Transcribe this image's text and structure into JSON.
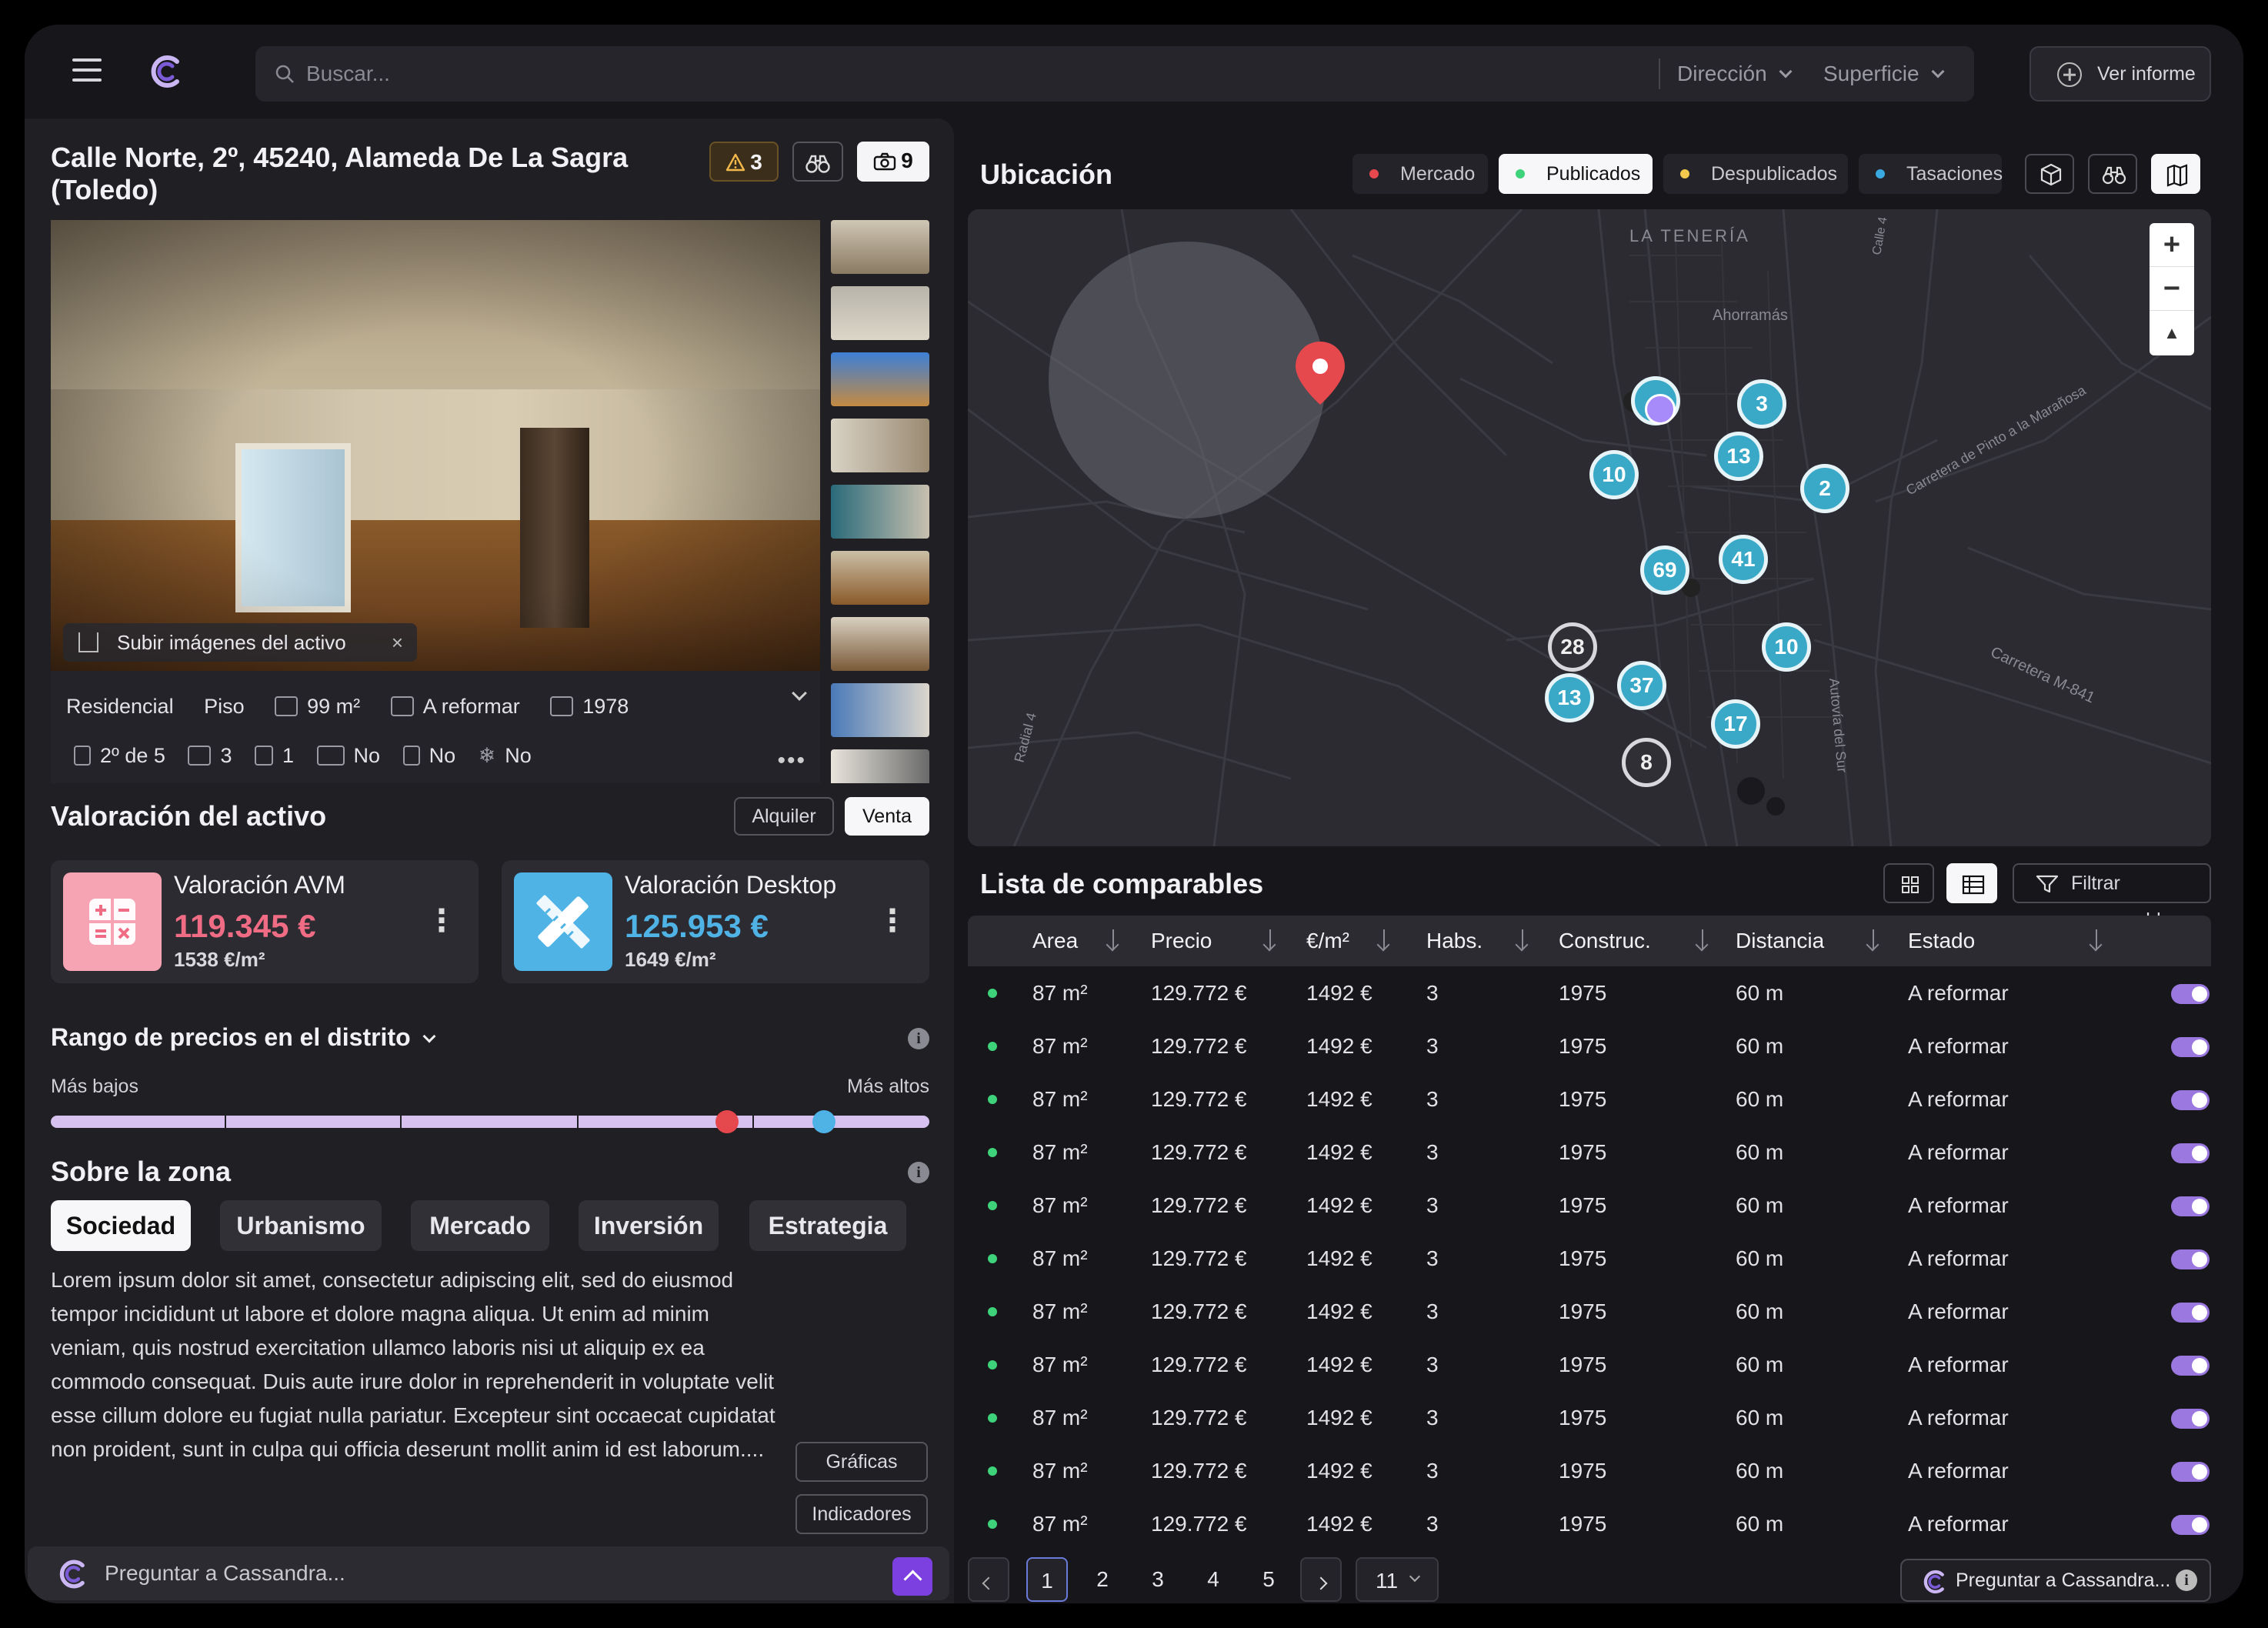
{
  "search": {
    "placeholder": "Buscar...",
    "filter_direccion": "Dirección",
    "filter_superficie": "Superficie"
  },
  "header": {
    "informe_label": "Ver informe"
  },
  "property": {
    "address": "Calle Norte, 2º, 45240, Alameda De La Sagra (Toledo)",
    "alerts_count": "3",
    "photos_count": "9",
    "upload_label": "Subir imágenes del activo",
    "features_row1": [
      "Residencial",
      "Piso",
      "99 m²",
      "A reformar",
      "1978"
    ],
    "features_row2": [
      "2º de 5",
      "3",
      "1",
      "No",
      "No",
      "No"
    ]
  },
  "valuation": {
    "title": "Valoración del activo",
    "toggle_alquiler": "Alquiler",
    "toggle_venta": "Venta",
    "avm": {
      "title": "Valoración AVM",
      "price": "119.345 €",
      "per_m2": "1538 €/m²",
      "color": "#f06b84"
    },
    "desktop": {
      "title": "Valoración Desktop",
      "price": "125.953 €",
      "per_m2": "1649 €/m²",
      "color": "#4fb3e6"
    }
  },
  "range": {
    "title": "Rango de precios en el distrito",
    "low": "Más bajos",
    "high": "Más altos",
    "marker_red": 0.77,
    "marker_blue": 0.88
  },
  "zone": {
    "title": "Sobre la zona",
    "tabs": [
      "Sociedad",
      "Urbanismo",
      "Mercado",
      "Inversión",
      "Estrategia"
    ],
    "text": "Lorem ipsum dolor sit amet, consectetur adipiscing elit, sed do eiusmod tempor incididunt ut labore et dolore magna aliqua. Ut enim ad minim veniam, quis nostrud exercitation ullamco laboris nisi ut aliquip ex ea commodo consequat. Duis aute irure dolor in reprehenderit in voluptate velit esse cillum dolore eu fugiat nulla pariatur. Excepteur sint occaecat cupidatat non proident, sunt in culpa qui officia deserunt mollit anim id est laborum....",
    "btn_graficas": "Gráficas",
    "btn_indicadores": "Indicadores"
  },
  "ask": {
    "placeholder": "Preguntar a Cassandra...",
    "label": "Preguntar a Cassandra..."
  },
  "location": {
    "title": "Ubicación",
    "legend": [
      {
        "label": "Mercado",
        "color": "#e5484d"
      },
      {
        "label": "Publicados",
        "color": "#3ed37a"
      },
      {
        "label": "Despublicados",
        "color": "#f2c94c"
      },
      {
        "label": "Tasaciones",
        "color": "#3aa9e0"
      }
    ],
    "map_labels": [
      "LA TENERÍA",
      "Ahorramás",
      "Carretera de Pinto a la Marañosa",
      "Carretera M-841",
      "Autovía del Sur",
      "Radial 4",
      "Calle 4"
    ],
    "clusters": [
      "3",
      "13",
      "10",
      "2",
      "41",
      "69",
      "10",
      "28",
      "37",
      "13",
      "17",
      "8"
    ]
  },
  "comparables": {
    "title": "Lista de comparables",
    "filter_label": "Filtrar comparables",
    "columns": [
      "Area",
      "Precio",
      "€/m²",
      "Habs.",
      "Construc.",
      "Distancia",
      "Estado"
    ],
    "rows": [
      [
        "87 m²",
        "129.772 €",
        "1492 €",
        "3",
        "1975",
        "60 m",
        "A reformar"
      ],
      [
        "87 m²",
        "129.772 €",
        "1492 €",
        "3",
        "1975",
        "60 m",
        "A reformar"
      ],
      [
        "87 m²",
        "129.772 €",
        "1492 €",
        "3",
        "1975",
        "60 m",
        "A reformar"
      ],
      [
        "87 m²",
        "129.772 €",
        "1492 €",
        "3",
        "1975",
        "60 m",
        "A reformar"
      ],
      [
        "87 m²",
        "129.772 €",
        "1492 €",
        "3",
        "1975",
        "60 m",
        "A reformar"
      ],
      [
        "87 m²",
        "129.772 €",
        "1492 €",
        "3",
        "1975",
        "60 m",
        "A reformar"
      ],
      [
        "87 m²",
        "129.772 €",
        "1492 €",
        "3",
        "1975",
        "60 m",
        "A reformar"
      ],
      [
        "87 m²",
        "129.772 €",
        "1492 €",
        "3",
        "1975",
        "60 m",
        "A reformar"
      ],
      [
        "87 m²",
        "129.772 €",
        "1492 €",
        "3",
        "1975",
        "60 m",
        "A reformar"
      ],
      [
        "87 m²",
        "129.772 €",
        "1492 €",
        "3",
        "1975",
        "60 m",
        "A reformar"
      ],
      [
        "87 m²",
        "129.772 €",
        "1492 €",
        "3",
        "1975",
        "60 m",
        "A reformar"
      ]
    ],
    "pages": [
      "1",
      "2",
      "3",
      "4",
      "5"
    ],
    "page_size": "11"
  }
}
